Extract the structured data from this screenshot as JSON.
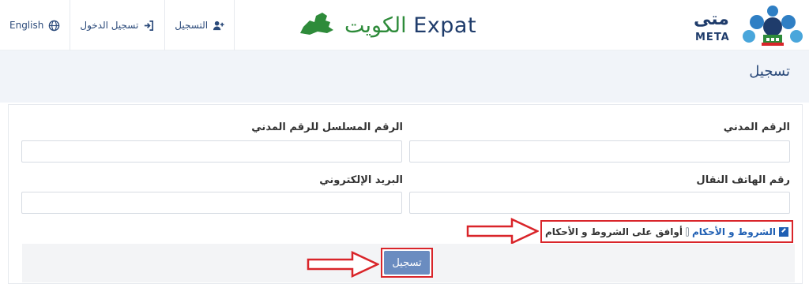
{
  "header": {
    "nav": {
      "english_label": "English",
      "login_label": "تسجيل الدخول",
      "register_label": "التسجيل"
    },
    "brand": {
      "latin": "Expat",
      "arabic": "الكويت"
    },
    "logo": {
      "arabic": "متى",
      "latin": "META"
    }
  },
  "page": {
    "title": "تسجيل"
  },
  "form": {
    "civil_id_label": "الرقم المدني",
    "serial_label": "الرقم المسلسل للرقم المدني",
    "phone_label": "رقم الهاتف النقال",
    "email_label": "البريد الإلكتروني",
    "civil_id_value": "",
    "serial_value": "",
    "phone_value": "",
    "email_value": "",
    "terms_link": "الشروط و الأحكام",
    "agree_label": "أوافق على الشروط و الأحكام",
    "agree_checked": false,
    "submit_label": "تسجيل"
  },
  "colors": {
    "primary": "#1f3c6b",
    "accent_green": "#2e8b3a",
    "button": "#6a8cc0",
    "highlight_red": "#d9252a"
  },
  "icons": [
    "globe-icon",
    "sign-in-icon",
    "user-plus-icon",
    "edit-icon",
    "arrow-icon"
  ]
}
